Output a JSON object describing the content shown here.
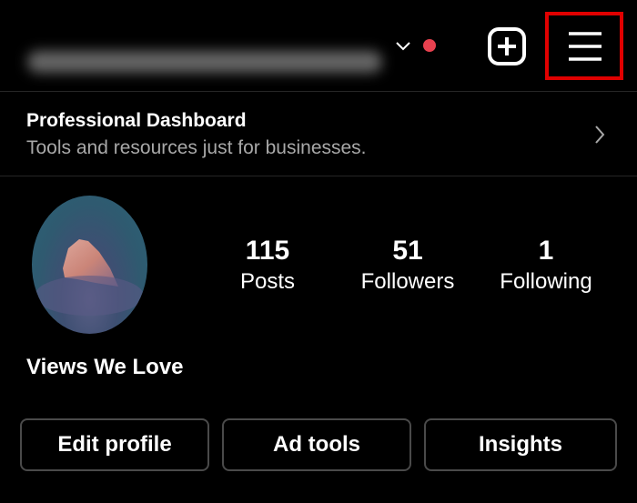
{
  "header": {
    "username_blurred": true,
    "notification_dot_color": "#e8414f",
    "highlight_color": "#e00000",
    "icons": [
      "chevron-down-icon",
      "plus-square-icon",
      "hamburger-menu-icon"
    ]
  },
  "dashboard": {
    "title": "Professional Dashboard",
    "subtitle": "Tools and resources just for businesses."
  },
  "profile": {
    "name": "Views We Love",
    "stats": [
      {
        "value": "115",
        "label": "Posts"
      },
      {
        "value": "51",
        "label": "Followers"
      },
      {
        "value": "1",
        "label": "Following"
      }
    ]
  },
  "buttons": {
    "edit_profile": "Edit profile",
    "ad_tools": "Ad tools",
    "insights": "Insights"
  }
}
